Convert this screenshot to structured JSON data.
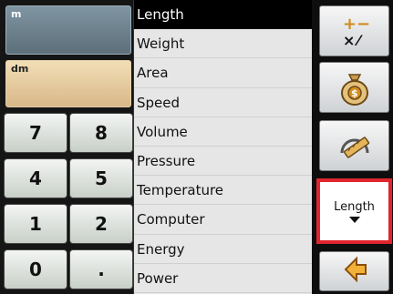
{
  "fields": {
    "source_unit": "m",
    "target_unit": "dm"
  },
  "keypad": {
    "keys": [
      "7",
      "8",
      "4",
      "5",
      "1",
      "2",
      "0",
      "."
    ]
  },
  "categories": {
    "items": [
      "Length",
      "Weight",
      "Area",
      "Speed",
      "Volume",
      "Pressure",
      "Temperature",
      "Computer",
      "Energy",
      "Power"
    ],
    "selected": "Length"
  },
  "toolbar": {
    "buttons": [
      "calculator-icon",
      "money-bag-icon",
      "ruler-icon",
      "length-selector",
      "back-arrow-icon"
    ],
    "length_label": "Length"
  },
  "colors": {
    "selection_border": "#e0252e",
    "source_field": "#6f8592",
    "target_field": "#e6c99a"
  }
}
